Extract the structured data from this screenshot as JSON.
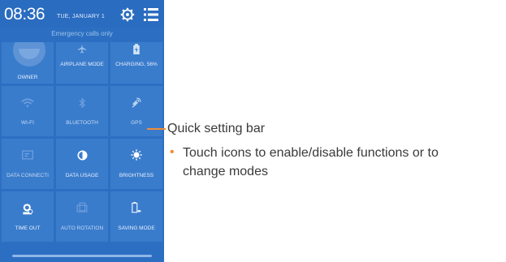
{
  "status_bar": {
    "time": "08:36",
    "date": "TUE, JANUARY 1",
    "emergency": "Emergency calls only",
    "settings_icon": "gear-icon",
    "menu_icon": "list-menu-icon"
  },
  "tiles": [
    {
      "label": "OWNER",
      "icon": "owner-avatar-icon",
      "active": true
    },
    {
      "label": "AIRPLANE MODE",
      "icon": "airplane-icon",
      "active": true
    },
    {
      "label": "CHARGING, 56%",
      "icon": "battery-charging-icon",
      "active": true
    },
    {
      "label": "WI-FI",
      "icon": "wifi-icon",
      "active": false
    },
    {
      "label": "BLUETOOTH",
      "icon": "bluetooth-icon",
      "active": false
    },
    {
      "label": "GPS",
      "icon": "gps-icon",
      "active": false
    },
    {
      "label": "DATA CONNECTI",
      "icon": "data-connection-icon",
      "active": false
    },
    {
      "label": "DATA USAGE",
      "icon": "data-usage-icon",
      "active": true
    },
    {
      "label": "BRIGHTNESS",
      "icon": "brightness-icon",
      "active": true
    },
    {
      "label": "TIME OUT",
      "icon": "timeout-icon",
      "active": true
    },
    {
      "label": "AUTO ROTATION",
      "icon": "auto-rotation-icon",
      "active": false
    },
    {
      "label": "SAVING MODE",
      "icon": "saving-mode-icon",
      "active": true
    }
  ],
  "callout": {
    "title": "Quick setting bar",
    "bullet": "•",
    "line1": "Touch icons to enable/disable functions or to",
    "line2": "change modes"
  },
  "colors": {
    "panel": "#2c6fc2",
    "tile": "#3a7ccc",
    "accent": "#f28c38"
  }
}
